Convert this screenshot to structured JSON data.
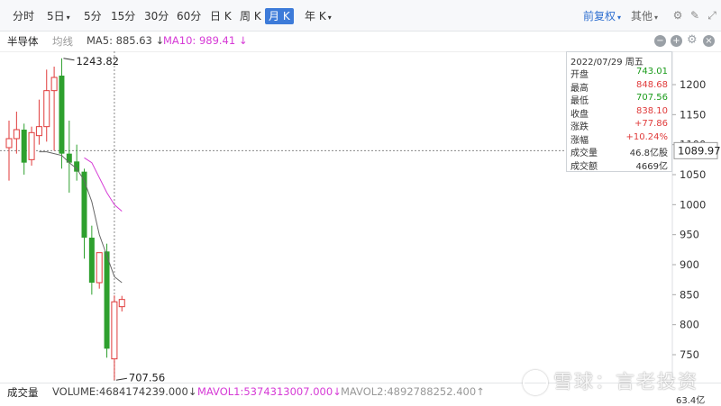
{
  "toolbar": {
    "tabs": [
      {
        "label": "分时"
      },
      {
        "label": "5日",
        "dropdown": true
      },
      {
        "label": "5分"
      },
      {
        "label": "15分"
      },
      {
        "label": "30分"
      },
      {
        "label": "60分"
      },
      {
        "label": "日 K"
      },
      {
        "label": "周 K"
      },
      {
        "label": "月 K",
        "active": true
      },
      {
        "label": "年 K",
        "dropdown": true
      }
    ],
    "adjust_label": "前复权",
    "other_label": "其他",
    "caret": "▾"
  },
  "infobar": {
    "stock_name": "半导体",
    "ma_toggle": "均线",
    "ma5": "MA5: 885.63 ↓",
    "ma10": "MA10: 989.41 ↓"
  },
  "tooltip": {
    "date": "2022/07/29 周五",
    "rows": [
      {
        "k": "开盘",
        "v": "743.01",
        "color": "#1a9b1a"
      },
      {
        "k": "最高",
        "v": "848.68",
        "color": "#e03a3a"
      },
      {
        "k": "最低",
        "v": "707.56",
        "color": "#1a9b1a"
      },
      {
        "k": "收盘",
        "v": "838.10",
        "color": "#e03a3a"
      },
      {
        "k": "涨跌",
        "v": "+77.86",
        "color": "#e03a3a"
      },
      {
        "k": "涨幅",
        "v": "+10.24%",
        "color": "#e03a3a"
      },
      {
        "k": "成交量",
        "v": "46.8亿股",
        "color": "#333333"
      },
      {
        "k": "成交额",
        "v": "4669亿",
        "color": "#333333"
      }
    ]
  },
  "volume_bar": {
    "label": "成交量",
    "volume": "VOLUME:4684174239.000↓",
    "mavol1": "MAVOL1:5374313007.000↓",
    "mavol2": "MAVOL2:4892788252.400↑",
    "axis_value": "63.4亿"
  },
  "watermark": "雪球：言老投资",
  "colors": {
    "up": "#e03a3a",
    "down": "#2ea02e",
    "ma5": "#666666",
    "ma10": "#d63bd6",
    "accent": "#3d7bd9"
  },
  "chart_data": {
    "type": "candlestick",
    "y_ticks": [
      750,
      800,
      850,
      900,
      950,
      1000,
      1050,
      1100,
      1150,
      1200
    ],
    "ylim": [
      700,
      1262
    ],
    "crosshair_value": "1089.97",
    "max_label": "1243.82",
    "min_label": "707.56",
    "candles": [
      {
        "open": 1095,
        "high": 1140,
        "low": 1040,
        "close": 1110
      },
      {
        "open": 1110,
        "high": 1155,
        "low": 1085,
        "close": 1125
      },
      {
        "open": 1125,
        "high": 1135,
        "low": 1050,
        "close": 1070
      },
      {
        "open": 1075,
        "high": 1130,
        "low": 1065,
        "close": 1120
      },
      {
        "open": 1115,
        "high": 1175,
        "low": 1100,
        "close": 1130
      },
      {
        "open": 1130,
        "high": 1225,
        "low": 1105,
        "close": 1190
      },
      {
        "open": 1190,
        "high": 1230,
        "low": 1090,
        "close": 1212
      },
      {
        "open": 1215,
        "high": 1243.82,
        "low": 1060,
        "close": 1085
      },
      {
        "open": 1085,
        "high": 1140,
        "low": 1020,
        "close": 1070
      },
      {
        "open": 1072,
        "high": 1100,
        "low": 1040,
        "close": 1055
      },
      {
        "open": 1055,
        "high": 1060,
        "low": 910,
        "close": 945
      },
      {
        "open": 945,
        "high": 965,
        "low": 850,
        "close": 870
      },
      {
        "open": 870,
        "high": 920,
        "low": 860,
        "close": 920
      },
      {
        "open": 922,
        "high": 935,
        "low": 745,
        "close": 760
      },
      {
        "open": 743.01,
        "high": 848.68,
        "low": 707.56,
        "close": 838.1
      },
      {
        "open": 830,
        "high": 848,
        "low": 822,
        "close": 842
      }
    ],
    "ma5": [
      null,
      null,
      null,
      null,
      1088,
      1088,
      1085,
      1082,
      1070,
      1060,
      1040,
      1005,
      950,
      915,
      880,
      870
    ],
    "ma10": [
      null,
      null,
      null,
      null,
      null,
      null,
      null,
      null,
      null,
      null,
      1078,
      1070,
      1045,
      1020,
      1000,
      989
    ]
  }
}
